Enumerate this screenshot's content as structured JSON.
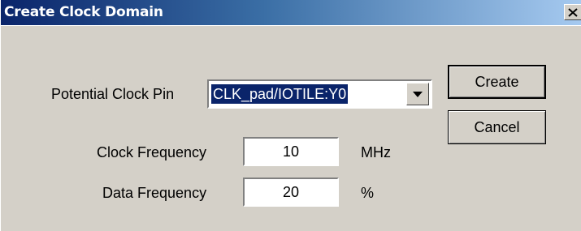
{
  "window": {
    "title": "Create Clock Domain",
    "close_glyph": "✕"
  },
  "form": {
    "clock_pin_label": "Potential Clock Pin",
    "clock_pin_value": "CLK_pad/IOTILE:Y0",
    "clock_freq_label": "Clock Frequency",
    "clock_freq_value": "10",
    "clock_freq_unit": "MHz",
    "data_freq_label": "Data Frequency",
    "data_freq_value": "20",
    "data_freq_unit": "%"
  },
  "buttons": {
    "create_label": "Create",
    "cancel_label": "Cancel"
  },
  "colors": {
    "titlebar_start": "#0a246a",
    "titlebar_end": "#a6caf0",
    "face": "#d4d0c8",
    "selection": "#0a246a"
  },
  "icons": {
    "close": "close-icon",
    "dropdown": "chevron-down-icon"
  }
}
